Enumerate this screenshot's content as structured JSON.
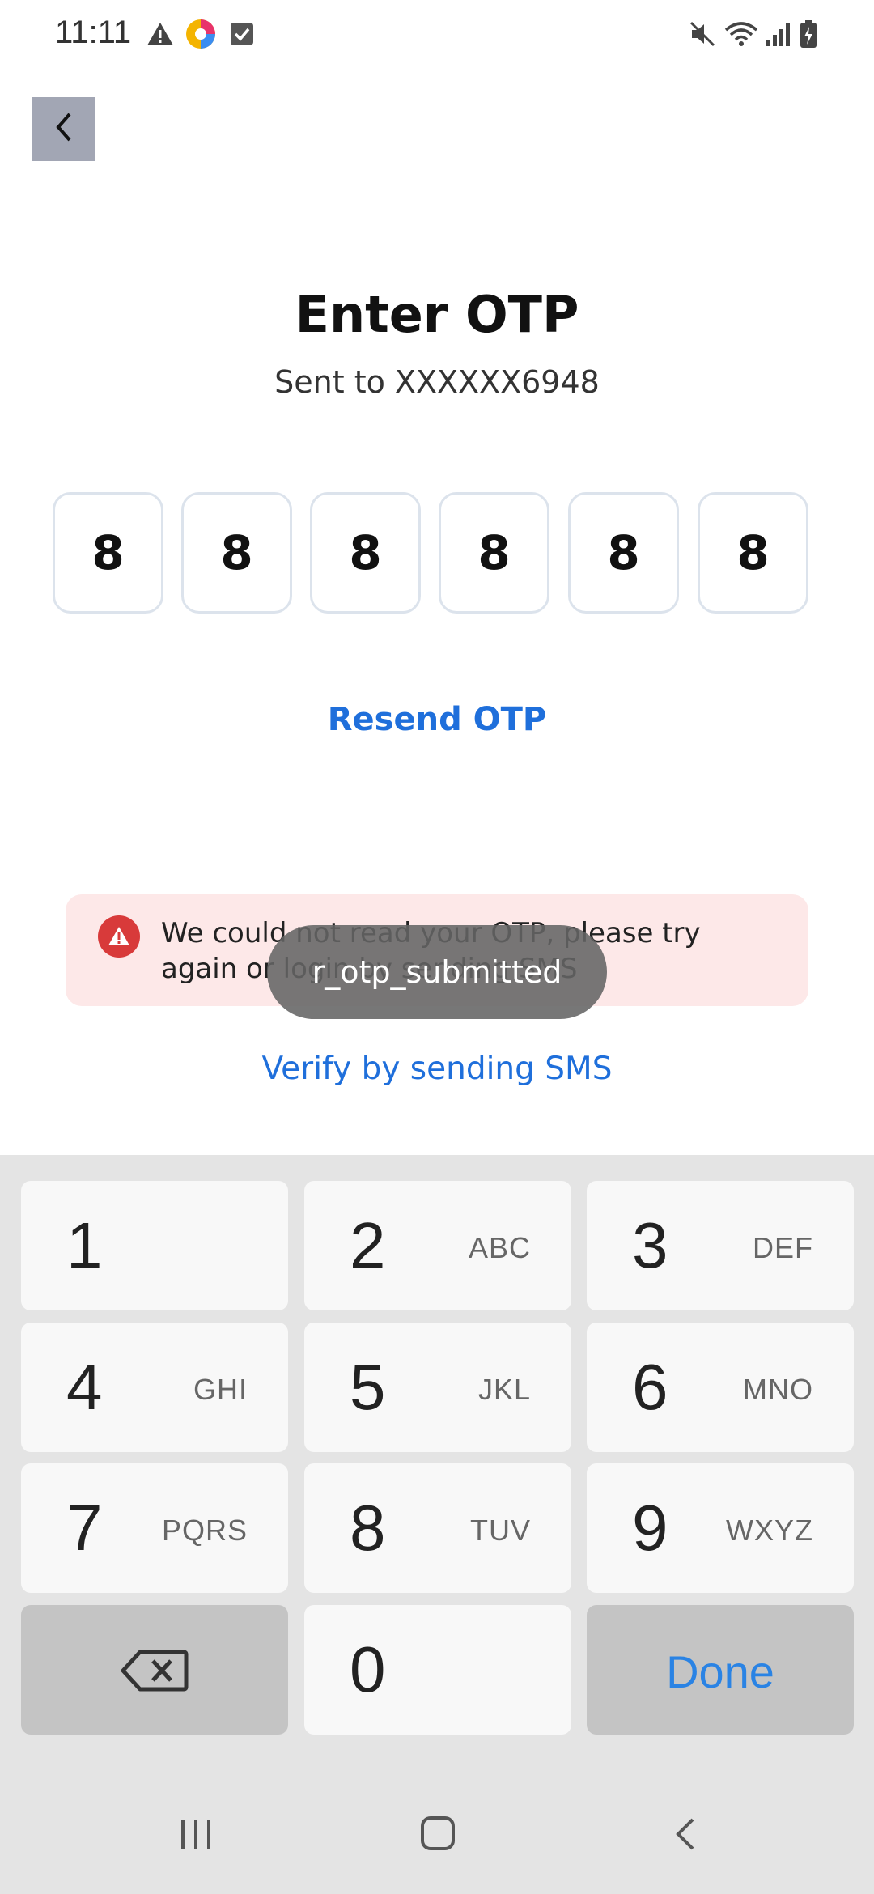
{
  "status_bar": {
    "time": "11:11",
    "left_icons": [
      "warning-icon",
      "app-icon",
      "checkbox-icon"
    ],
    "right_icons": [
      "mute-icon",
      "wifi-icon",
      "signal-icon",
      "battery-icon"
    ]
  },
  "header": {
    "back_icon": "chevron-left-icon"
  },
  "main": {
    "title": "Enter OTP",
    "subtitle": "Sent to XXXXXX6948",
    "otp_digits": [
      "8",
      "8",
      "8",
      "8",
      "8",
      "8"
    ],
    "resend_label": "Resend OTP",
    "error_message": "We could not read your OTP, please try again or login by sending SMS",
    "verify_sms_label": "Verify by sending SMS"
  },
  "toast": {
    "text": "r_otp_submitted"
  },
  "keyboard": {
    "keys": [
      {
        "num": "1",
        "letters": ""
      },
      {
        "num": "2",
        "letters": "ABC"
      },
      {
        "num": "3",
        "letters": "DEF"
      },
      {
        "num": "4",
        "letters": "GHI"
      },
      {
        "num": "5",
        "letters": "JKL"
      },
      {
        "num": "6",
        "letters": "MNO"
      },
      {
        "num": "7",
        "letters": "PQRS"
      },
      {
        "num": "8",
        "letters": "TUV"
      },
      {
        "num": "9",
        "letters": "WXYZ"
      },
      {
        "num": "0",
        "letters": ""
      }
    ],
    "done_label": "Done"
  },
  "colors": {
    "accent": "#1f6fdb",
    "error_bg": "#fde8e8",
    "error_icon": "#d83a3a",
    "back_button_bg": "#a2a6b4"
  }
}
